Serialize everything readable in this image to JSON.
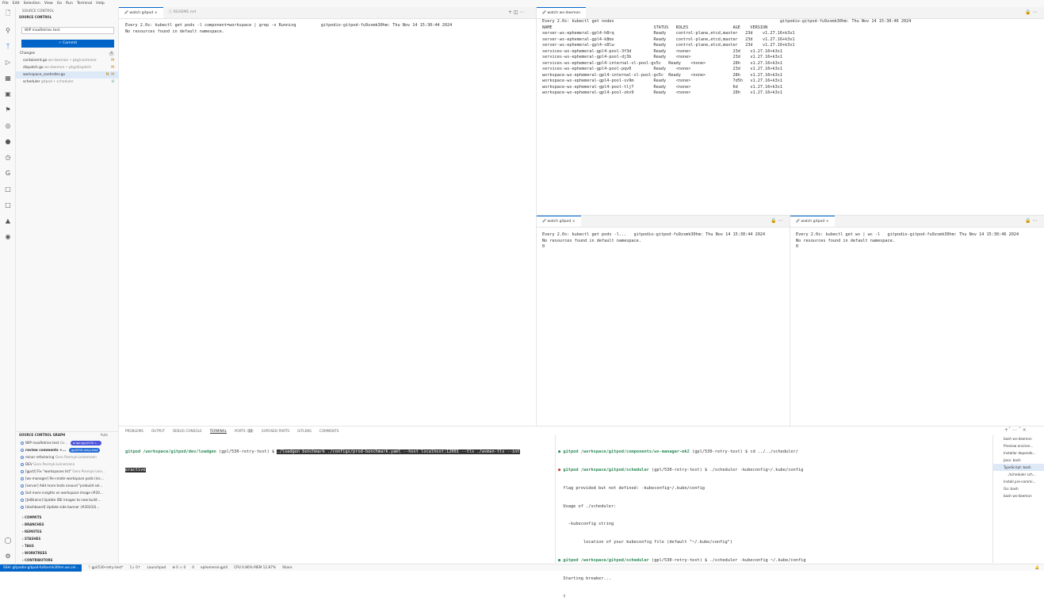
{
  "menu": [
    "File",
    "Edit",
    "Selection",
    "View",
    "Go",
    "Run",
    "Terminal",
    "Help"
  ],
  "activity_icons": [
    "explorer-icon",
    "search-icon",
    "source-control-icon",
    "run-debug-icon",
    "extensions-icon",
    "remote-explorer-icon",
    "testing-icon",
    "gitlens-icon",
    "github-icon",
    "timeline-icon",
    "gitpod-icon",
    "gitlens-inspect-icon",
    "gitlens-graph-icon",
    "docker-icon",
    "ports-icon"
  ],
  "sidebar": {
    "header": "SOURCE CONTROL",
    "section": "SOURCE CONTROL",
    "message": "WIP maxRetries test",
    "commit_label": "✓ Commit",
    "changes_label": "Changes",
    "changes_count": "4",
    "changes": [
      {
        "file": "containerd.go",
        "path": "ws-daemon • pkg/container",
        "status": "M"
      },
      {
        "file": "dispatch.go",
        "path": "ws-daemon • pkg/dispatch",
        "status": "M"
      },
      {
        "file": "workspace_controller.go",
        "path": "",
        "status": "M, M"
      },
      {
        "file": "scheduler",
        "path": "gitpod • scheduler",
        "status": "U"
      }
    ],
    "graph_header": "SOURCE CONTROL GRAPH",
    "graph_auto": "Auto",
    "graph": [
      {
        "msg": "WIP maxRetries test",
        "author": "Ge...",
        "ref": "origin/gpl/530-r..."
      },
      {
        "msg": "review comments +...",
        "author": "",
        "ref": "gpl/530-retry-test"
      },
      {
        "msg": "minor refactoring",
        "author": "Gero Posmyk-Leinemann",
        "ref": ""
      },
      {
        "msg": "DEV",
        "author": "Gero Posmyk-Leinemann",
        "ref": ""
      },
      {
        "msg": "[gpctl] Fix \"workspaces list\"",
        "author": "Gero Posmyk-Lein...",
        "ref": ""
      },
      {
        "msg": "[ws-manager] Re-create workspace pods (inc...",
        "author": "",
        "ref": ""
      },
      {
        "msg": "[server] Add more tests around \"prebuild sel...",
        "author": "",
        "ref": ""
      },
      {
        "msg": "Get more insights on workspace image (#20...",
        "author": "",
        "ref": ""
      },
      {
        "msg": "[JetBrains] Update IDE images to new build ...",
        "author": "",
        "ref": ""
      },
      {
        "msg": "[dashboard] Update side banner (#20333)...",
        "author": "",
        "ref": ""
      }
    ],
    "categories": [
      "COMMITS",
      "BRANCHES",
      "REMOTES",
      "STASHES",
      "TAGS",
      "WORKTREES",
      "CONTRIBUTORS"
    ]
  },
  "editor_left": {
    "tabs": [
      {
        "label": "watch gitpod",
        "active": true
      },
      {
        "label": "README.md",
        "active": false
      }
    ],
    "lines": [
      "Every 2.0s: kubectl get pods -l component=workspace | grep -v Running          gitpodio-gitpod-fu9zxmk30hm: Thu Nov 14 15:30:44 2024",
      "",
      "No resources found in default namespace."
    ]
  },
  "editor_top_right": {
    "tab": "watch ws-daemon",
    "lines": [
      "Every 2.0s: kubectl get nodes                                                                   gitpodio-gitpod-fu9zxmk30hm: Thu Nov 14 15:30:46 2024",
      "",
      "NAME                                         STATUS   ROLES                  AGE    VERSION",
      "server-ws-ephemeral-gpl4-h8rq                Ready    control-plane,etcd,master   23d    v1.27.16+k3s1",
      "server-ws-ephemeral-gpl4-k8mx                Ready    control-plane,etcd,master   23d    v1.27.16+k3s1",
      "server-ws-ephemeral-gpl4-s8lw                Ready    control-plane,etcd,master   23d    v1.27.16+k3s1",
      "services-ws-ephemeral-gpl4-pool-3f3d         Ready    <none>                 23d    v1.27.16+k3s1",
      "services-ws-ephemeral-gpl4-pool-dj3b         Ready    <none>                 23d    v1.27.16+k3s1",
      "services-ws-ephemeral-gpl4-internal-xl-pool-gv5c   Ready    <none>           28h    v1.27.16+k3s1",
      "services-ws-ephemeral-gpl4-pool-pqv0         Ready    <none>                 23d    v1.27.16+k3s1",
      "workspace-ws-ephemeral-gpl4-internal-xl-pool-gv5c  Ready    <none>           28h    v1.27.16+k3s1",
      "workspace-ws-ephemeral-gpl4-pool-sv9m        Ready    <none>                 7d5h   v1.27.16+k3s1",
      "workspace-ws-ephemeral-gpl4-pool-tlj7        Ready    <none>                 6d     v1.27.16+k3s1",
      "workspace-ws-ephemeral-gpl4-pool-zkv9        Ready    <none>                 28h    v1.27.16+k3s1"
    ]
  },
  "editor_mid": {
    "tab": "watch gitpod",
    "lines": [
      "Every 2.0s: kubectl get pods -l...   gitpodio-gitpod-fu9zxmk30hm: Thu Nov 14 15:30:44 2024",
      "",
      "No resources found in default namespace.",
      "0"
    ]
  },
  "editor_right": {
    "tab": "watch gitpod",
    "lines": [
      "Every 2.0s: kubectl get ws | wc -l   gitpodio-gitpod-fu9zxmk30hm: Thu Nov 14 15:30:46 2024",
      "",
      "No resources found in default namespace.",
      "0"
    ]
  },
  "panel": {
    "tabs": [
      "PROBLEMS",
      "OUTPUT",
      "DEBUG CONSOLE",
      "TERMINAL",
      "PORTS",
      "EXPOSED PORTS",
      "GITLENS",
      "COMMENTS"
    ],
    "ports_count": "30",
    "term1": {
      "prompt": "gitpod /workspace/gitpod/dev/loadgen",
      "branch": "(gpl/530-retry-test) $",
      "cmd_line1": "./loadgen benchmark ./configs/prod-benchmark.yaml --host localhost:12001 --tls ./wsman-tls --int",
      "cmd_line2": "eractive"
    },
    "term2": [
      {
        "prompt": "gitpod /workspace/gitpod/components/ws-manager-mk2",
        "rest": " (gpl/530-retry-test) $ cd ../../scheduler/"
      },
      {
        "prompt": "gitpod /workspace/gitpod/scheduler",
        "rest": " (gpl/530-retry-test) $ ./scheduler -kubeconfig~/.kube/config"
      },
      {
        "prompt": "",
        "rest": "flag provided but not defined: -kubeconfig~/.kube/config"
      },
      {
        "prompt": "",
        "rest": "Usage of ./scheduler:"
      },
      {
        "prompt": "",
        "rest": "  -kubeconfig string"
      },
      {
        "prompt": "",
        "rest": "        location of your kubeconfig file (default \"~/.kube/config\")"
      },
      {
        "prompt": "gitpod /workspace/gitpod/scheduler",
        "rest": " (gpl/530-retry-test) $ ./scheduler -kubeconfig ~/.kube/config"
      },
      {
        "prompt": "",
        "rest": "Starting breaker..."
      }
    ],
    "terminals": [
      "bash ws-daemon",
      "Preview environ...",
      "Installer depende...",
      "Java: bash",
      "TypeScript: bash",
      "./scheduler  sch...",
      "Install pre-commi...",
      "Go: bash",
      "bash ws-daemon"
    ]
  },
  "status": {
    "remote": "SSH: gitpodio-gitpod-fu9zxmk30hm.ws.cel...",
    "branch": "gpl/530-retry-test*",
    "sync": "1↓ 0↑",
    "launchpad": "Launchpad",
    "problems": "⊗ 0 ⚠ 0",
    "ports": "0",
    "context": "ephemeral-gpl4",
    "cpu": "CPU 0.86% MEM 12.87%",
    "share": "Share"
  }
}
